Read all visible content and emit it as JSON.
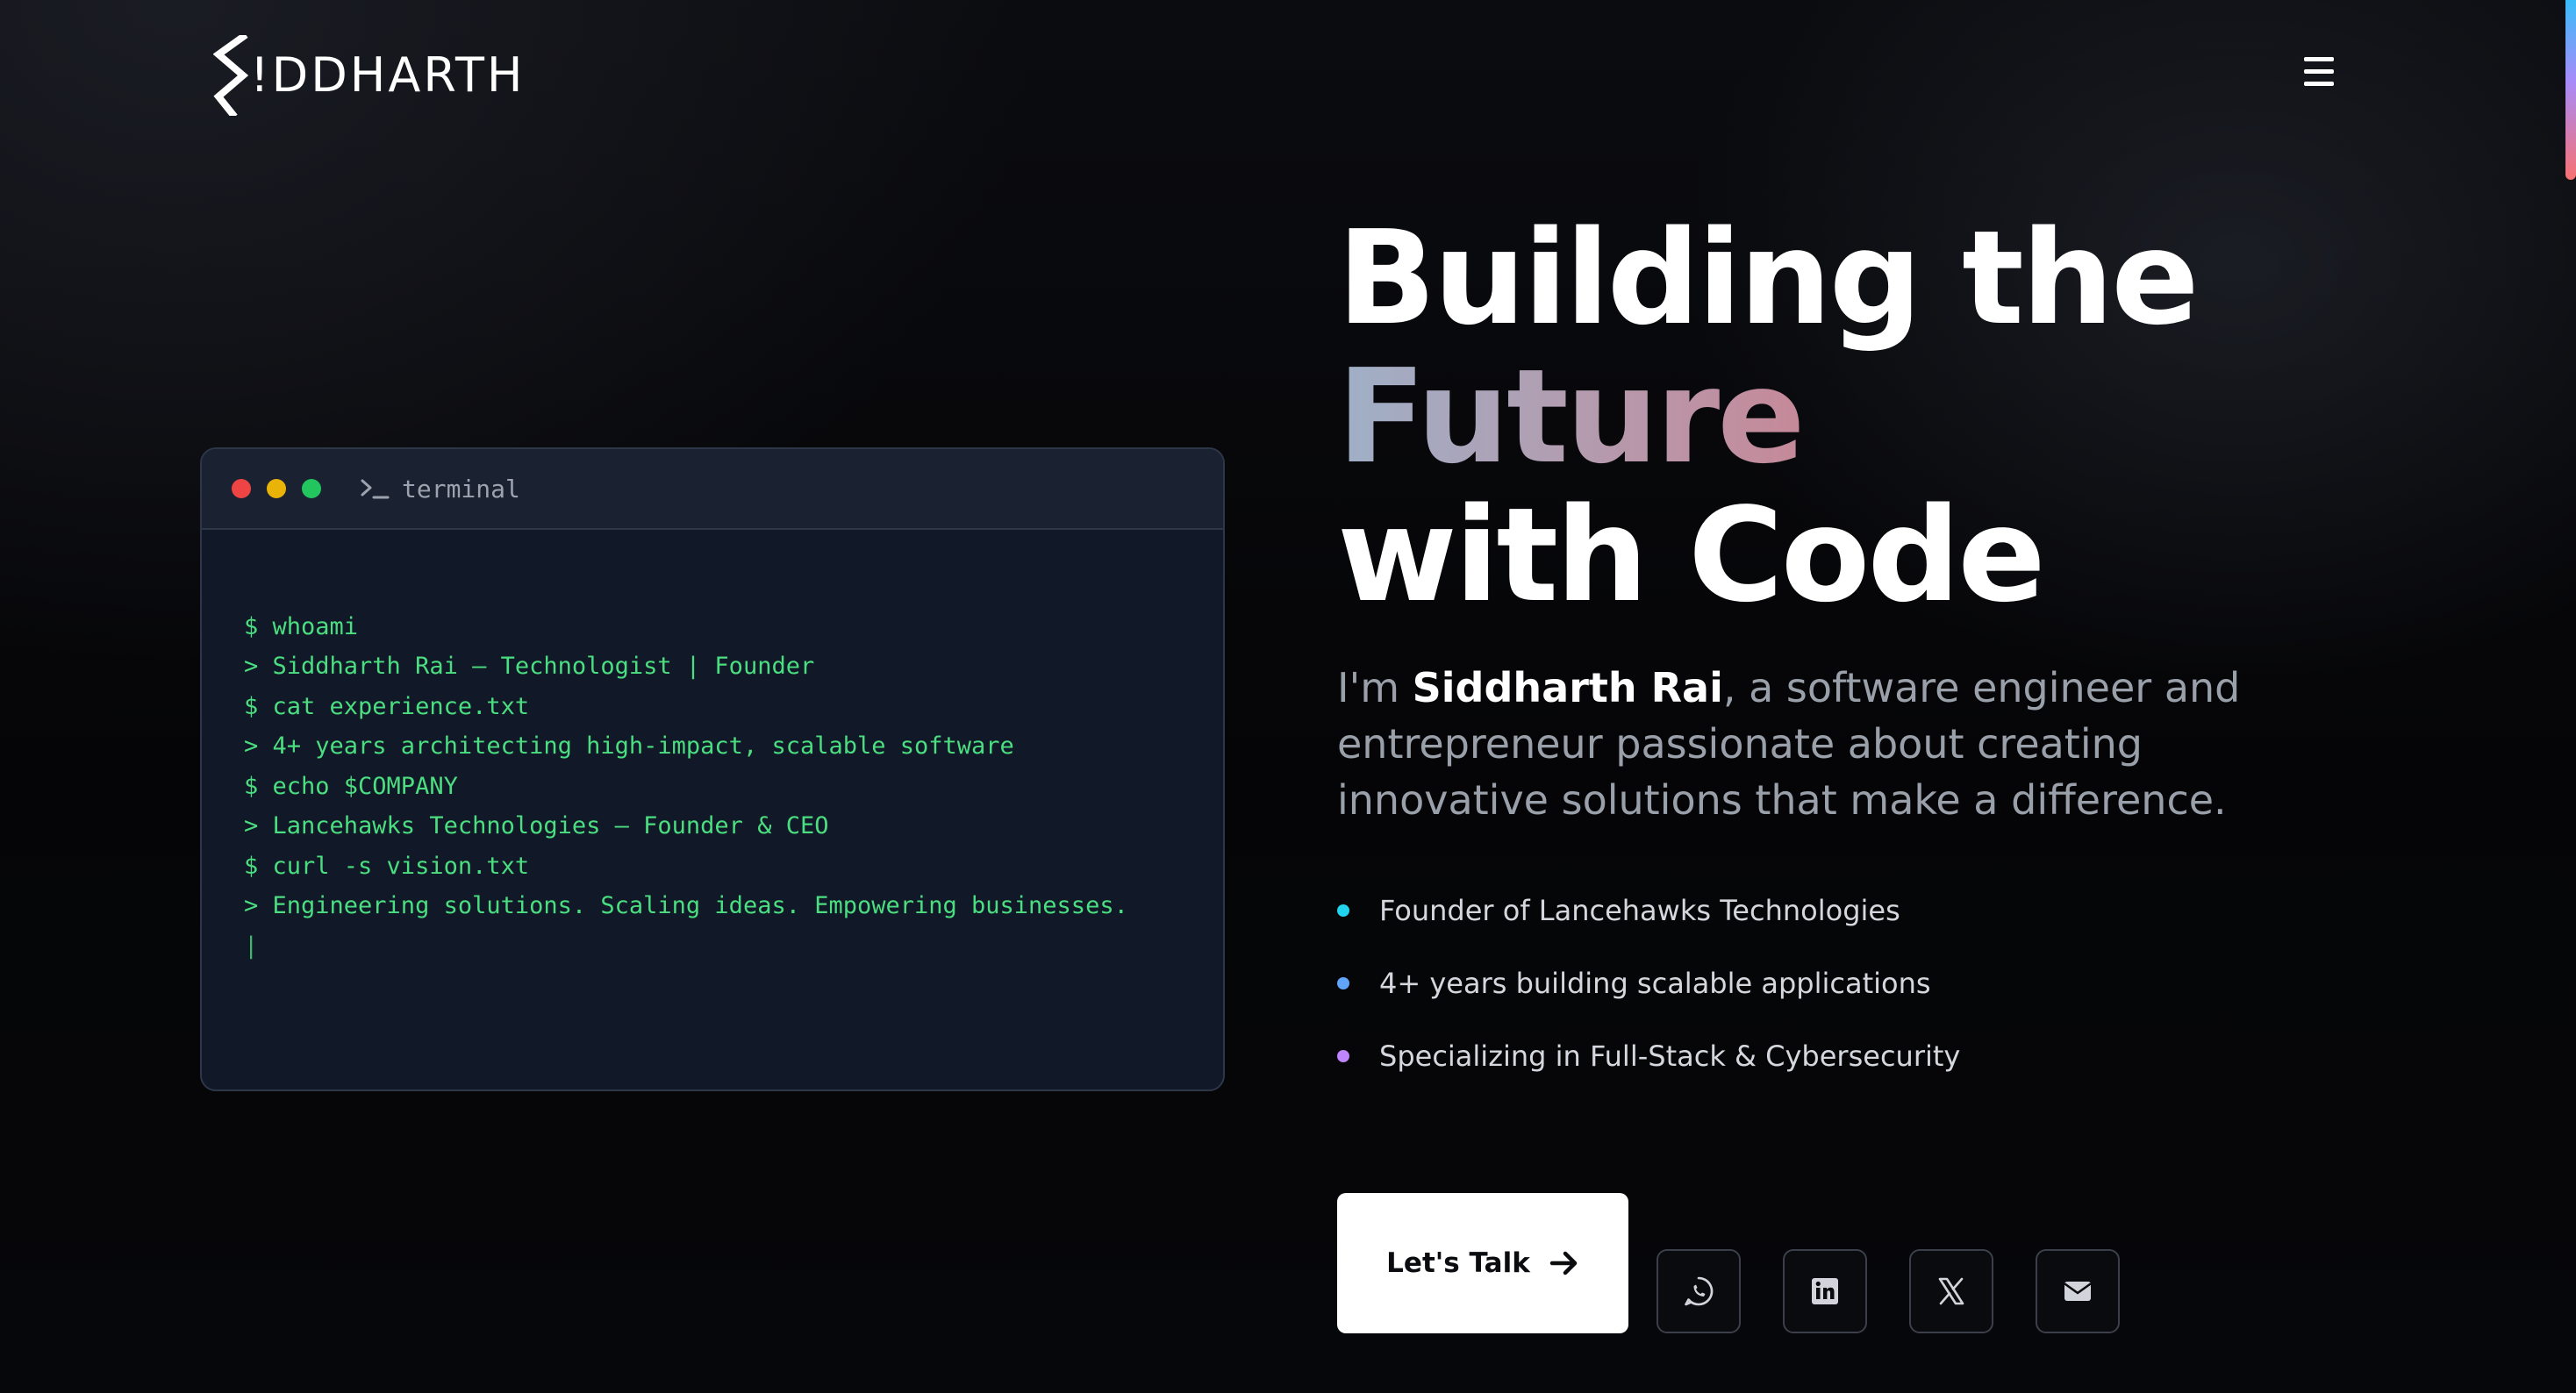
{
  "header": {
    "logo_text": "!DDHARTH",
    "menu_icon": "hamburger-menu-icon"
  },
  "terminal": {
    "title": "terminal",
    "window_dots": [
      "#ef4444",
      "#eab308",
      "#22c55e"
    ],
    "lines": [
      "$ whoami",
      "> Siddharth Rai — Technologist | Founder",
      "$ cat experience.txt",
      "> 4+ years architecting high-impact, scalable software",
      "$ echo $COMPANY",
      "> Lancehawks Technologies — Founder & CEO",
      "$ curl -s vision.txt",
      "> Engineering solutions. Scaling ideas. Empowering businesses."
    ],
    "cursor": "|"
  },
  "hero": {
    "title_line1": "Building the",
    "title_line2": "Future",
    "title_line3": "with Code",
    "intro_prefix": "I'm ",
    "intro_name": "Siddharth Rai",
    "intro_suffix": ", a software engineer and entrepreneur passionate about creating innovative solutions that make a difference."
  },
  "highlights": [
    {
      "text": "Founder of Lancehawks Technologies",
      "color": "#22d3ee"
    },
    {
      "text": "4+ years building scalable applications",
      "color": "#60a5fa"
    },
    {
      "text": "Specializing in Full-Stack & Cybersecurity",
      "color": "#c084fc"
    }
  ],
  "cta": {
    "label": "Let's Talk",
    "icon": "arrow-right-icon"
  },
  "socials": [
    {
      "name": "whatsapp",
      "icon": "whatsapp-icon"
    },
    {
      "name": "linkedin",
      "icon": "linkedin-icon"
    },
    {
      "name": "x",
      "icon": "x-icon"
    },
    {
      "name": "email",
      "icon": "email-icon"
    }
  ],
  "colors": {
    "accent_gradient": [
      "#9fb0c7",
      "#c58a9a",
      "#e87474"
    ],
    "terminal_text": "#4ade80",
    "scroll_indicator": [
      "#38bdf8",
      "#a78bfa",
      "#f87171"
    ]
  }
}
